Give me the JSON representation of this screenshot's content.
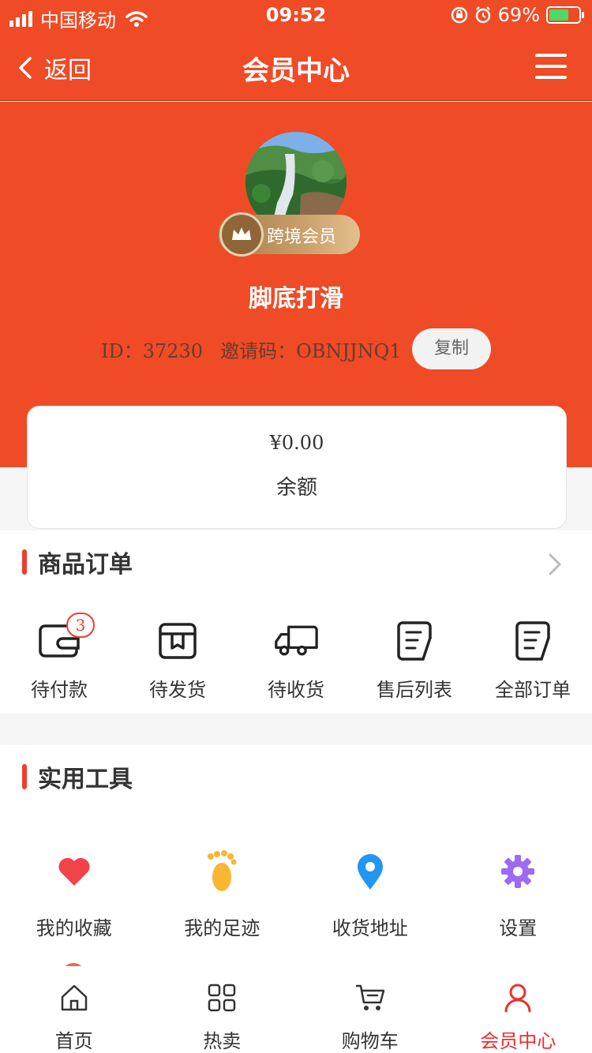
{
  "status_bar": {
    "carrier": "中国移动",
    "time": "09:52",
    "battery": "69%"
  },
  "nav": {
    "back_label": "返回",
    "title": "会员中心"
  },
  "profile": {
    "badge": "跨境会员",
    "username": "脚底打滑",
    "id_text": "ID：37230",
    "invite_text": "邀请码：OBNJJNQ1",
    "copy_label": "复制"
  },
  "balance": {
    "value": "¥0.00",
    "label": "余额"
  },
  "orders": {
    "title": "商品订单",
    "items": [
      {
        "label": "待付款",
        "badge": "3",
        "icon": "wallet-icon"
      },
      {
        "label": "待发货",
        "icon": "package-icon"
      },
      {
        "label": "待收货",
        "icon": "truck-icon"
      },
      {
        "label": "售后列表",
        "icon": "document-icon"
      },
      {
        "label": "全部订单",
        "icon": "document-icon"
      }
    ]
  },
  "tools": {
    "title": "实用工具",
    "items": [
      {
        "label": "我的收藏",
        "icon": "heart-icon",
        "color": "#f2434b"
      },
      {
        "label": "我的足迹",
        "icon": "footprint-icon",
        "color": "#f7b733"
      },
      {
        "label": "收货地址",
        "icon": "location-pin-icon",
        "color": "#2196f3"
      },
      {
        "label": "设置",
        "icon": "gear-icon",
        "color": "#9b6bf2"
      }
    ]
  },
  "tabbar": {
    "items": [
      {
        "label": "首页",
        "icon": "home-icon",
        "active": false
      },
      {
        "label": "热卖",
        "icon": "grid-icon",
        "active": false
      },
      {
        "label": "购物车",
        "icon": "cart-icon",
        "active": false
      },
      {
        "label": "会员中心",
        "icon": "user-icon",
        "active": true
      }
    ]
  },
  "colors": {
    "brand": "#ef4b26",
    "accent_red": "#ef2e2e",
    "gold": "#c9a06a"
  }
}
